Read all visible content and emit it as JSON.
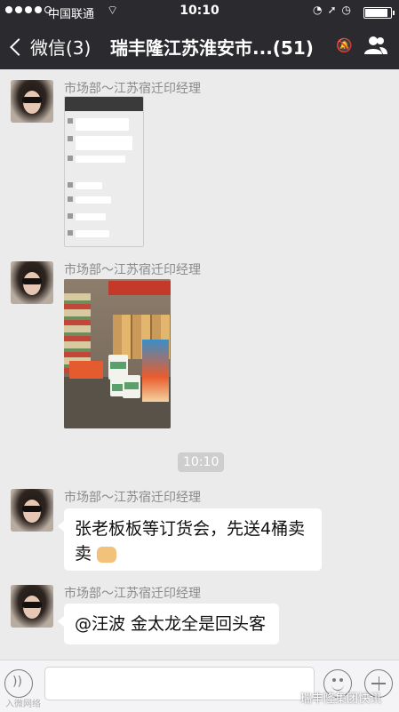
{
  "status": {
    "carrier": "中国联通",
    "time": "10:10",
    "battery_level": 0.9
  },
  "nav": {
    "back_label": "微信(3)",
    "title": "瑞丰隆江苏淮安市...(51)"
  },
  "messages": [
    {
      "sender": "市场部～江苏宿迁印经理",
      "type": "image"
    },
    {
      "sender": "市场部～江苏宿迁印经理",
      "type": "image"
    },
    {
      "sender": "市场部～江苏宿迁印经理",
      "type": "text",
      "text_line1": "张老板板等订货会，先送4桶卖",
      "text_line2": "卖"
    },
    {
      "sender": "市场部～江苏宿迁印经理",
      "type": "text",
      "text": "@汪波 金太龙全是回头客"
    }
  ],
  "timestamp": "10:10",
  "watermarks": {
    "left": "入微网络",
    "right": "瑞丰隆集团快讯"
  },
  "icons": [
    "back-chevron-icon",
    "mute-icon",
    "group-members-icon",
    "voice-icon",
    "emoji-icon",
    "plus-icon"
  ]
}
